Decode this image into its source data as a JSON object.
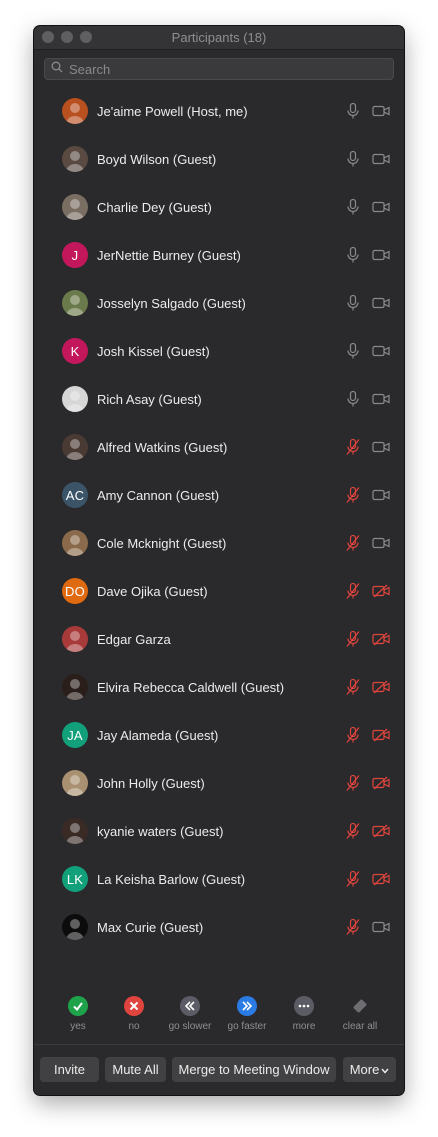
{
  "window": {
    "title": "Participants (18)"
  },
  "search": {
    "placeholder": "Search"
  },
  "participants": [
    {
      "name": "Je'aime Powell (Host, me)",
      "avatar": "photo",
      "color": "#b8501f",
      "mic": "on",
      "video": "on"
    },
    {
      "name": "Boyd Wilson (Guest)",
      "avatar": "photo",
      "color": "#5a4a42",
      "mic": "on",
      "video": "on"
    },
    {
      "name": "Charlie Dey (Guest)",
      "avatar": "photo",
      "color": "#7a6e62",
      "mic": "on",
      "video": "on"
    },
    {
      "name": "JerNettie Burney (Guest)",
      "avatar": "J",
      "color": "#c2185b",
      "mic": "on",
      "video": "on"
    },
    {
      "name": "Josselyn Salgado (Guest)",
      "avatar": "photo",
      "color": "#6b7a4a",
      "mic": "on",
      "video": "on"
    },
    {
      "name": "Josh Kissel (Guest)",
      "avatar": "K",
      "color": "#c2185b",
      "mic": "on",
      "video": "on"
    },
    {
      "name": "Rich Asay (Guest)",
      "avatar": "photo",
      "color": "#d6d6d6",
      "mic": "on",
      "video": "on"
    },
    {
      "name": "Alfred Watkins (Guest)",
      "avatar": "photo",
      "color": "#4a3a34",
      "mic": "muted",
      "video": "on"
    },
    {
      "name": "Amy Cannon (Guest)",
      "avatar": "AC",
      "color": "#3c5468",
      "mic": "muted",
      "video": "on"
    },
    {
      "name": "Cole Mcknight (Guest)",
      "avatar": "photo",
      "color": "#8a6a4a",
      "mic": "muted",
      "video": "on"
    },
    {
      "name": "Dave Ojika (Guest)",
      "avatar": "DO",
      "color": "#e06a10",
      "mic": "muted",
      "video": "off"
    },
    {
      "name": "Edgar Garza",
      "avatar": "photo",
      "color": "#a83a3a",
      "mic": "muted",
      "video": "off"
    },
    {
      "name": "Elvira Rebecca Caldwell (Guest)",
      "avatar": "photo",
      "color": "#2a1e1a",
      "mic": "muted",
      "video": "off"
    },
    {
      "name": "Jay Alameda (Guest)",
      "avatar": "JA",
      "color": "#12a07a",
      "mic": "muted",
      "video": "off"
    },
    {
      "name": "John Holly (Guest)",
      "avatar": "photo",
      "color": "#a89070",
      "mic": "muted",
      "video": "off"
    },
    {
      "name": "kyanie waters (Guest)",
      "avatar": "photo",
      "color": "#3a2a26",
      "mic": "muted",
      "video": "off"
    },
    {
      "name": "La Keisha Barlow (Guest)",
      "avatar": "LK",
      "color": "#12a07a",
      "mic": "muted",
      "video": "off"
    },
    {
      "name": "Max Curie (Guest)",
      "avatar": "photo",
      "color": "#0c0c0c",
      "mic": "muted",
      "video": "on"
    }
  ],
  "feedback": [
    {
      "label": "yes",
      "icon": "check-icon",
      "color": "#1fa34a"
    },
    {
      "label": "no",
      "icon": "x-icon",
      "color": "#e0443e"
    },
    {
      "label": "go slower",
      "icon": "rewind-icon",
      "color": "#5c5c66"
    },
    {
      "label": "go faster",
      "icon": "fast-forward-icon",
      "color": "#2a7be4"
    },
    {
      "label": "more",
      "icon": "ellipsis-icon",
      "color": "#5c5c66"
    },
    {
      "label": "clear all",
      "icon": "eraser-icon",
      "color": "#5c5c60"
    }
  ],
  "buttons": {
    "invite": "Invite",
    "mute_all": "Mute All",
    "merge": "Merge to Meeting Window",
    "more": "More"
  },
  "colors": {
    "muted_icon": "#e0443e",
    "icon_gray": "#8a8a8e",
    "background": "#2a2a2c"
  }
}
